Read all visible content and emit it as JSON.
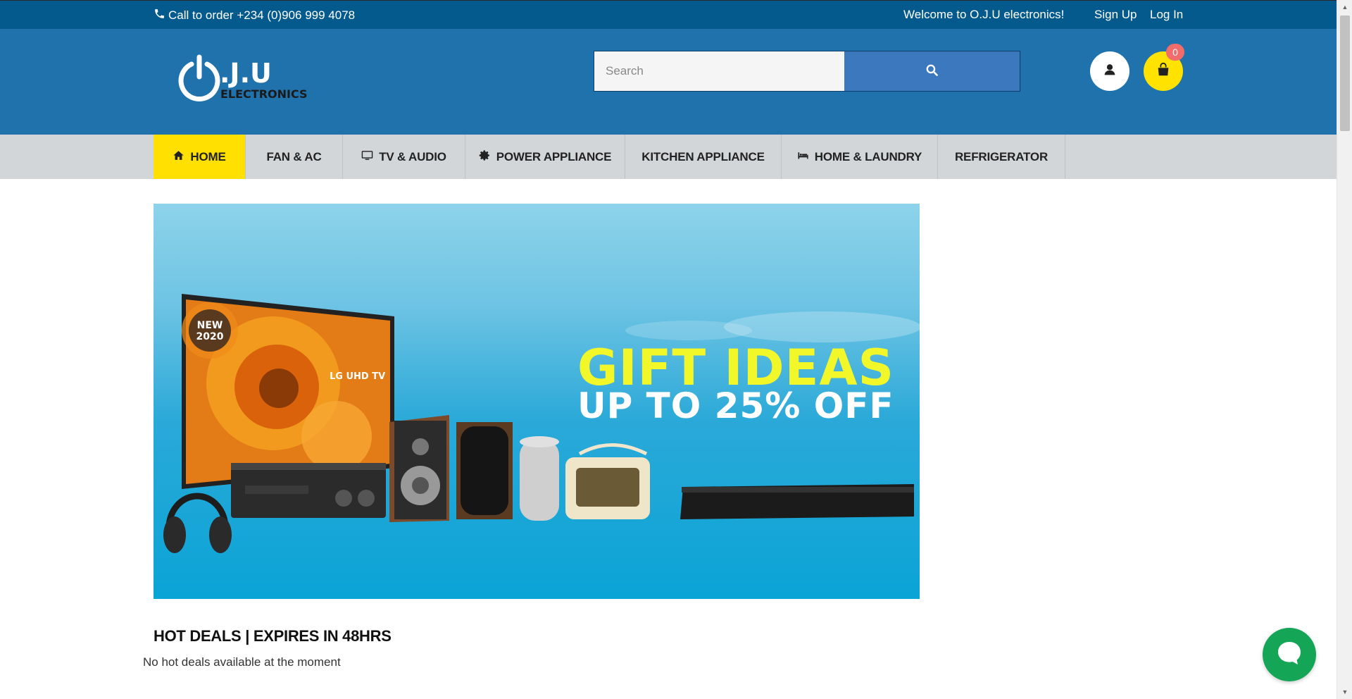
{
  "topbar": {
    "phone_text": "Call to order +234 (0)906 999 4078",
    "welcome_text": "Welcome to O.J.U electronics!",
    "signup_label": "Sign Up",
    "login_label": "Log In"
  },
  "header": {
    "logo_main": ".J.U",
    "logo_sub": "ELECTRONICS",
    "search_placeholder": "Search",
    "cart_count": "0"
  },
  "nav": {
    "items": [
      {
        "label": "HOME",
        "icon": "home-icon",
        "active": true
      },
      {
        "label": "FAN & AC",
        "icon": "",
        "active": false
      },
      {
        "label": "TV & AUDIO",
        "icon": "tv-icon",
        "active": false
      },
      {
        "label": "POWER APPLIANCE",
        "icon": "gear-icon",
        "active": false
      },
      {
        "label": "KITCHEN APPLIANCE",
        "icon": "",
        "active": false
      },
      {
        "label": "HOME & LAUNDRY",
        "icon": "bed-icon",
        "active": false
      },
      {
        "label": "REFRIGERATOR",
        "icon": "",
        "active": false
      }
    ]
  },
  "banner": {
    "headline": "GIFT IDEAS",
    "subline": "UP TO 25% OFF",
    "tv_badge": "NEW 2020",
    "tv_brand": "LG UHD TV"
  },
  "deals": {
    "title": "HOT DEALS | EXPIRES IN 48HRS",
    "empty_text": "No hot deals available at the moment"
  },
  "colors": {
    "topbar": "#045a8d",
    "header": "#2072ac",
    "nav_bg": "#d3d6d9",
    "accent_yellow": "#ffe000",
    "chat_green": "#14a557"
  }
}
